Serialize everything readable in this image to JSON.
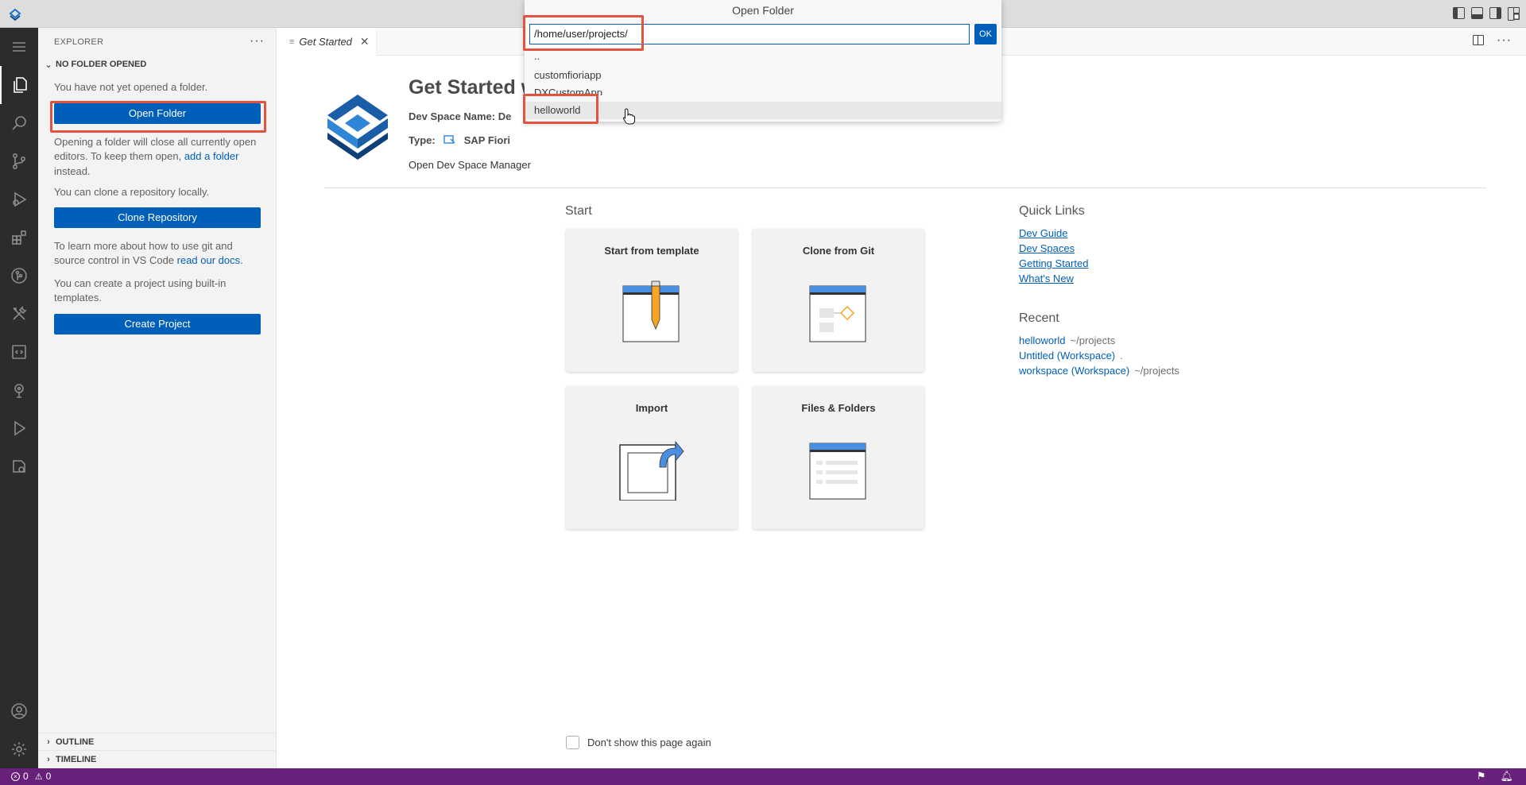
{
  "titlebar": {
    "dialog_title": "Open Folder"
  },
  "activity_bar": {
    "items": [
      "explorer-icon",
      "search-icon",
      "source-control-icon",
      "run-debug-icon",
      "extensions-icon",
      "git-graph-icon",
      "tools-icon",
      "code-snippet-icon",
      "deploy-icon",
      "run-icon",
      "storage-icon"
    ],
    "bottom": [
      "account-icon",
      "settings-gear-icon"
    ]
  },
  "sidebar": {
    "title": "EXPLORER",
    "more": "···",
    "section_title": "NO FOLDER OPENED",
    "not_opened_text": "You have not yet opened a folder.",
    "open_folder_button": "Open Folder",
    "close_editors_text_pre": "Opening a folder will close all currently open editors. To keep them open, ",
    "add_folder_link": "add a folder",
    "close_editors_text_post": " instead.",
    "clone_text": "You can clone a repository locally.",
    "clone_button": "Clone Repository",
    "git_text_pre": "To learn more about how to use git and source control in VS Code ",
    "docs_link": "read our docs",
    "git_text_post": ".",
    "create_text": "You can create a project using built-in templates.",
    "create_button": "Create Project",
    "outline": "OUTLINE",
    "timeline": "TIMELINE"
  },
  "tabs": {
    "active_label": "Get Started",
    "close": "✕"
  },
  "get_started": {
    "title": "Get Started w",
    "dev_space_label": "Dev Space Name:",
    "dev_space_value": "De",
    "type_label": "Type:",
    "type_value": "SAP Fiori",
    "manager_link": "Open Dev Space Manager",
    "start_title": "Start",
    "cards": [
      "Start from template",
      "Clone from Git",
      "Import",
      "Files & Folders"
    ],
    "quick_links_title": "Quick Links",
    "quick_links": [
      "Dev Guide",
      "Dev Spaces",
      "Getting Started",
      "What's New"
    ],
    "recent_title": "Recent",
    "recent": [
      {
        "name": "helloworld",
        "path": "~/projects"
      },
      {
        "name": "Untitled (Workspace)",
        "path": "."
      },
      {
        "name": "workspace (Workspace)",
        "path": "~/projects"
      }
    ],
    "dont_show": "Don't show this page again"
  },
  "quick_input": {
    "value": "/home/user/projects/",
    "ok_label": "OK",
    "items": [
      "..",
      "customfioriapp",
      "DXCustomApp",
      "helloworld"
    ],
    "selected_item": "helloworld"
  },
  "statusbar": {
    "errors": "0",
    "warnings": "0"
  },
  "colors": {
    "accent": "#005fb8",
    "statusbar": "#68217a",
    "highlight": "#e0533f",
    "activitybar": "#2c2c2c"
  }
}
